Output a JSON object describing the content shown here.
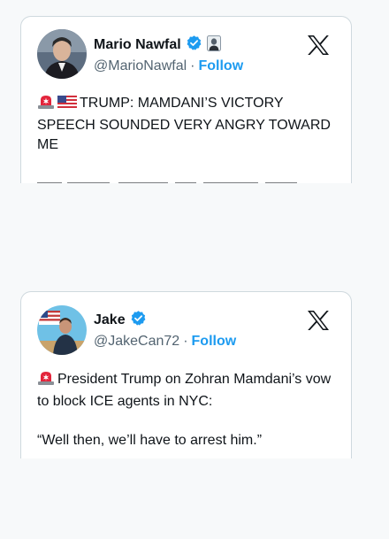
{
  "tweets": [
    {
      "name": "Mario Nawfal",
      "handle": "@MarioNawfal",
      "follow": "Follow",
      "separator": "·",
      "text": "TRUMP: MAMDANI’S VICTORY SPEECH SOUNDED VERY ANGRY TOWARD ME",
      "icons": [
        "siren-emoji",
        "us-flag-emoji"
      ]
    },
    {
      "name": "Jake",
      "handle": "@JakeCan72",
      "follow": "Follow",
      "separator": "·",
      "text": "President Trump on Zohran Mamdani’s vow to block ICE agents in NYC:",
      "quote": "“Well then, we’ll have to arrest him.”",
      "icons": [
        "siren-emoji"
      ]
    }
  ],
  "colors": {
    "follow": "#1d9bf0",
    "verified": "#1d9bf0",
    "name": "#0f1419",
    "handle": "#536471"
  }
}
